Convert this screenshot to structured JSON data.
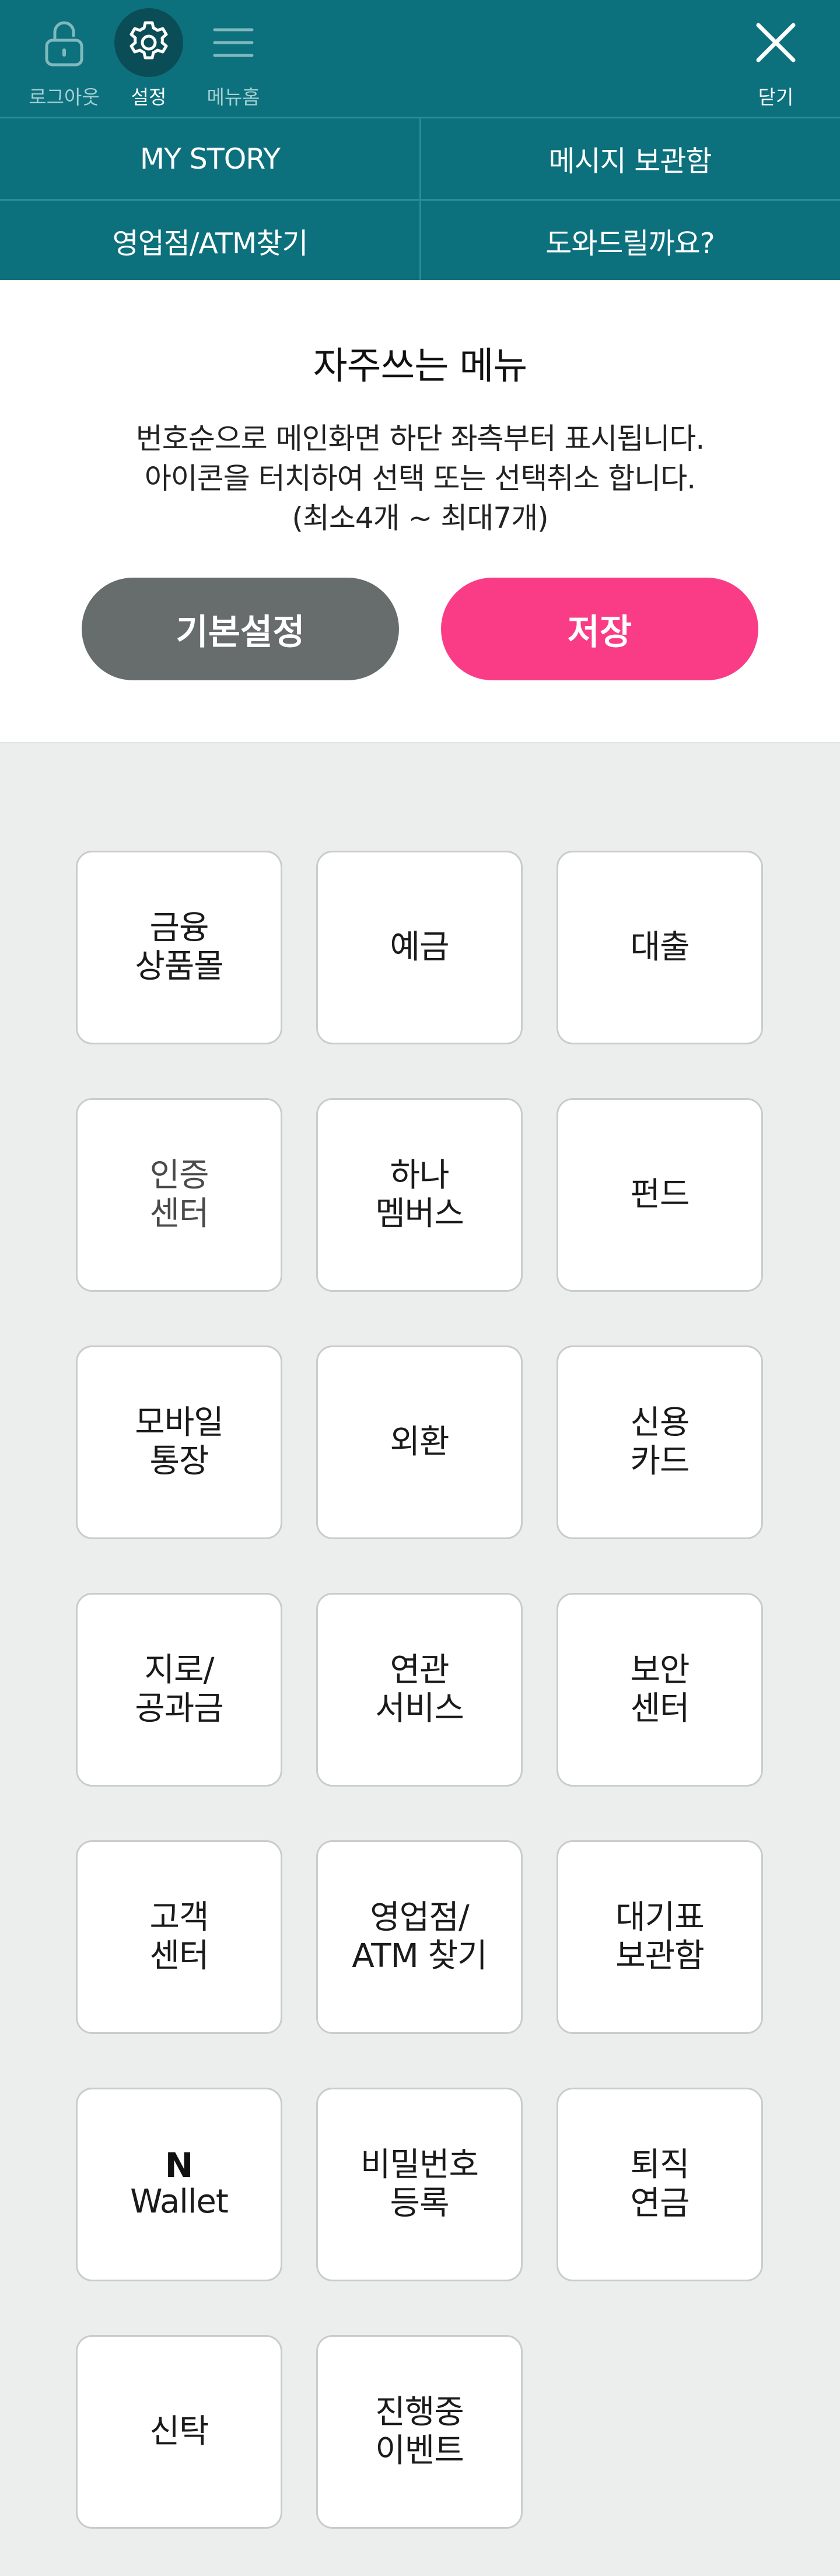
{
  "topbar": {
    "logout_label": "로그아웃",
    "settings_label": "설정",
    "menu_home_label": "메뉴홈",
    "close_label": "닫기"
  },
  "quicklinks": {
    "my_story": "MY STORY",
    "message_box": "메시지 보관함",
    "branch_atm": "영업점/ATM찾기",
    "help": "도와드릴까요?"
  },
  "panel": {
    "title": "자주쓰는 메뉴",
    "desc_line1": "번호순으로 메인화면 하단 좌측부터 표시됩니다.",
    "desc_line2": "아이콘을 터치하여 선택 또는 선택취소 합니다.",
    "desc_line3": "(최소4개 ~ 최대7개)",
    "default_button": "기본설정",
    "save_button": "저장"
  },
  "menu_tiles": [
    {
      "line1": "금융",
      "line2": "상품몰"
    },
    {
      "line1": "예금",
      "line2": ""
    },
    {
      "line1": "대출",
      "line2": ""
    },
    {
      "line1": "인증",
      "line2": "센터"
    },
    {
      "line1": "하나",
      "line2": "멤버스"
    },
    {
      "line1": "펀드",
      "line2": ""
    },
    {
      "line1": "모바일",
      "line2": "통장"
    },
    {
      "line1": "외환",
      "line2": ""
    },
    {
      "line1": "신용",
      "line2": "카드"
    },
    {
      "line1": "지로/",
      "line2": "공과금"
    },
    {
      "line1": "연관",
      "line2": "서비스"
    },
    {
      "line1": "보안",
      "line2": "센터"
    },
    {
      "line1": "고객",
      "line2": "센터"
    },
    {
      "line1": "영업점/",
      "line2": "ATM 찾기"
    },
    {
      "line1": "대기표",
      "line2": "보관함"
    },
    {
      "line1": "N",
      "line2": "Wallet"
    },
    {
      "line1": "비밀번호",
      "line2": "등록"
    },
    {
      "line1": "퇴직",
      "line2": "연금"
    },
    {
      "line1": "신탁",
      "line2": ""
    },
    {
      "line1": "진행중",
      "line2": "이벤트"
    }
  ],
  "colors": {
    "header_bg": "#0c717d",
    "settings_active_bg": "#0b4d57",
    "default_button_bg": "#676d6c",
    "save_button_bg": "#fa3c86",
    "page_bg": "#eceeed"
  },
  "icons": [
    "unlock-icon",
    "gear-icon",
    "hamburger-menu-icon",
    "close-icon"
  ]
}
